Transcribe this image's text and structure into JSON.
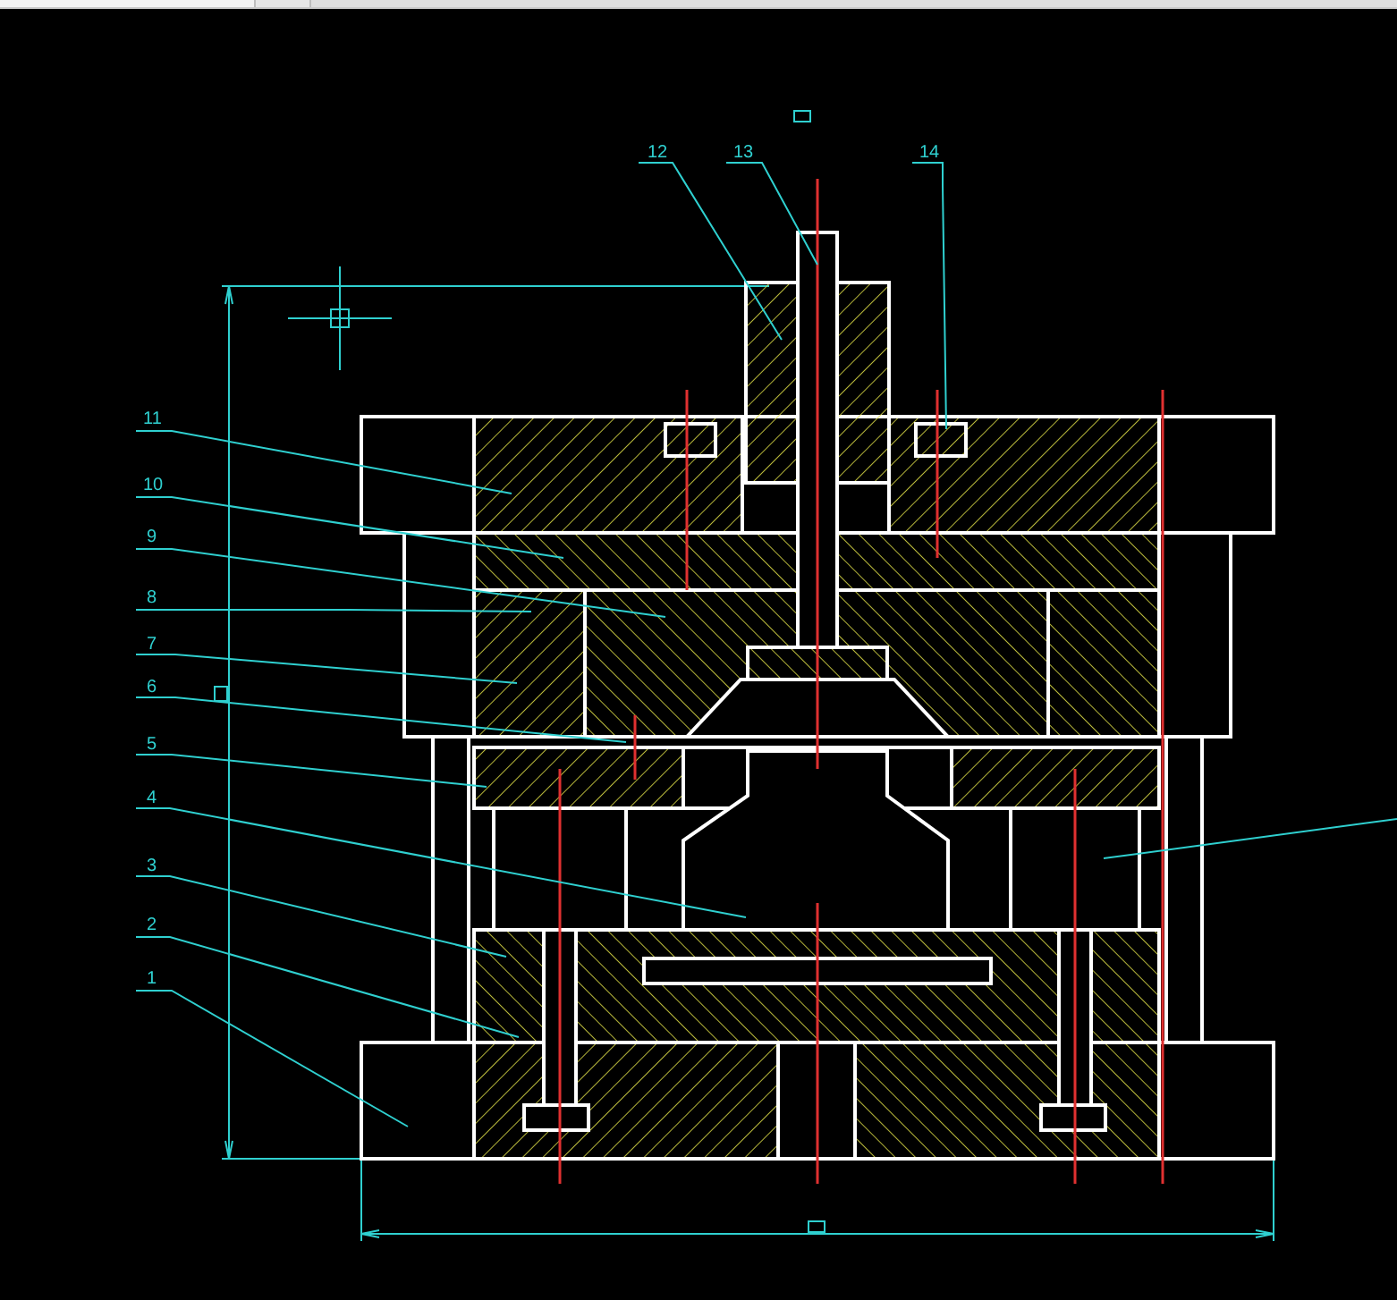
{
  "canvas": {
    "part_labels": [
      {
        "text": "12"
      },
      {
        "text": "13"
      },
      {
        "text": "14"
      },
      {
        "text": "11"
      },
      {
        "text": "10"
      },
      {
        "text": "9"
      },
      {
        "text": "8"
      },
      {
        "text": "7"
      },
      {
        "text": "6"
      },
      {
        "text": "5"
      },
      {
        "text": "4"
      },
      {
        "text": "3"
      },
      {
        "text": "2"
      },
      {
        "text": "1"
      }
    ]
  }
}
